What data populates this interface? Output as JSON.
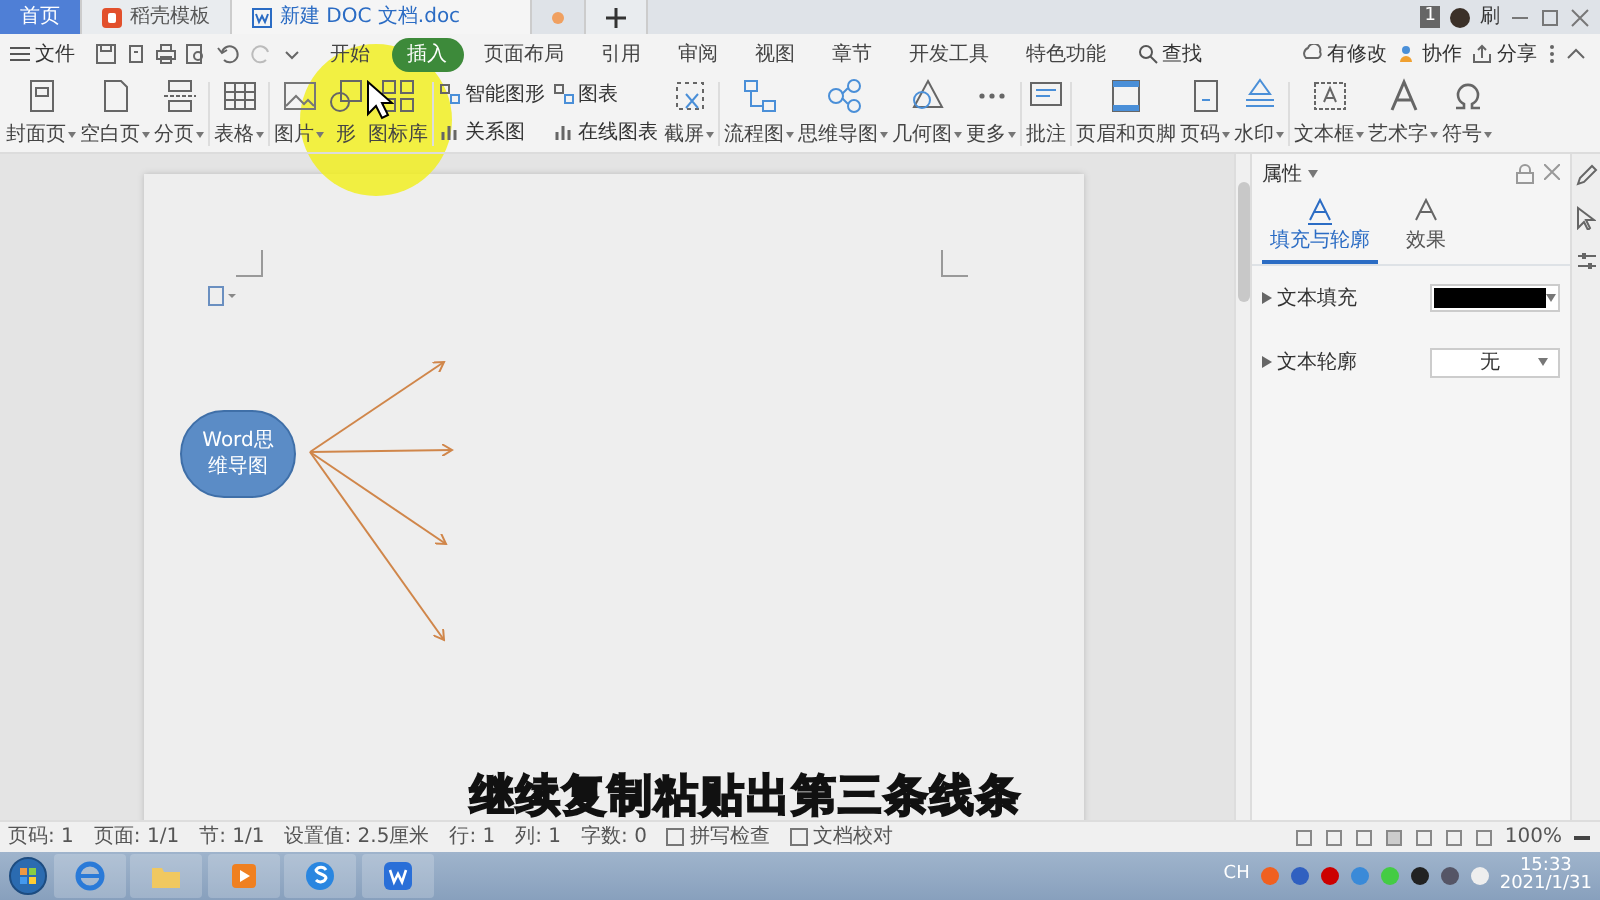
{
  "tabs": [
    {
      "label": "首页",
      "kind": "home",
      "selected": false
    },
    {
      "label": "稻壳模板",
      "kind": "docer",
      "selected": false
    },
    {
      "label": "新建 DOC 文档.doc",
      "kind": "doc",
      "selected": true
    }
  ],
  "account": {
    "badge": "1",
    "name": "刷"
  },
  "menu": {
    "file": "文件",
    "tabs": [
      {
        "label": "开始",
        "selected": false
      },
      {
        "label": "插入",
        "selected": true
      },
      {
        "label": "页面布局",
        "selected": false
      },
      {
        "label": "引用",
        "selected": false
      },
      {
        "label": "审阅",
        "selected": false
      },
      {
        "label": "视图",
        "selected": false
      },
      {
        "label": "章节",
        "selected": false
      },
      {
        "label": "开发工具",
        "selected": false
      },
      {
        "label": "特色功能",
        "selected": false
      }
    ],
    "search": "查找",
    "actions": [
      "有修改",
      "协作",
      "分享"
    ]
  },
  "ribbon": [
    {
      "kind": "large",
      "label": "封面页",
      "dropdown": true
    },
    {
      "kind": "large",
      "label": "空白页",
      "dropdown": true
    },
    {
      "kind": "large",
      "label": "分页",
      "dropdown": true
    },
    {
      "kind": "large",
      "label": "表格",
      "dropdown": true
    },
    {
      "kind": "large",
      "label": "图片",
      "dropdown": true
    },
    {
      "kind": "large",
      "label": "形",
      "dropdown": false
    },
    {
      "kind": "large",
      "label": "图标库",
      "dropdown": false
    },
    {
      "kind": "small",
      "label": "智能图形",
      "label2": "关系图"
    },
    {
      "kind": "small",
      "label": "图表",
      "label2": "在线图表"
    },
    {
      "kind": "large",
      "label": "截屏",
      "dropdown": true
    },
    {
      "kind": "large",
      "label": "流程图",
      "dropdown": true
    },
    {
      "kind": "large",
      "label": "思维导图",
      "dropdown": true
    },
    {
      "kind": "large",
      "label": "几何图",
      "dropdown": true
    },
    {
      "kind": "large",
      "label": "更多",
      "dropdown": true
    },
    {
      "kind": "large",
      "label": "批注",
      "dropdown": false
    },
    {
      "kind": "large",
      "label": "页眉和页脚",
      "dropdown": false
    },
    {
      "kind": "large",
      "label": "页码",
      "dropdown": true
    },
    {
      "kind": "large",
      "label": "水印",
      "dropdown": true
    },
    {
      "kind": "large",
      "label": "文本框",
      "dropdown": true
    },
    {
      "kind": "large",
      "label": "艺术字",
      "dropdown": true
    },
    {
      "kind": "large",
      "label": "符号",
      "dropdown": true
    }
  ],
  "document": {
    "node": "Word思维导图",
    "subtitle": "继续复制粘贴出第三条线条"
  },
  "panel": {
    "title": "属性",
    "tabs": [
      {
        "label": "填充与轮廓",
        "selected": true
      },
      {
        "label": "效果",
        "selected": false
      }
    ],
    "rows": [
      {
        "kind": "swatch",
        "label": "文本填充",
        "color": "#000000"
      },
      {
        "kind": "select",
        "label": "文本轮廓",
        "value": "无"
      }
    ]
  },
  "status_bar": {
    "items": [
      "页码: 1",
      "页面: 1/1",
      "节: 1/1",
      "设置值: 2.5厘米",
      "行: 1",
      "列: 1",
      "字数: 0"
    ],
    "checks": [
      "拼写检查",
      "文档校对"
    ],
    "zoom": "100%"
  },
  "taskbar": {
    "ime": "CH",
    "time": "15:33",
    "date": "2021/1/31"
  }
}
